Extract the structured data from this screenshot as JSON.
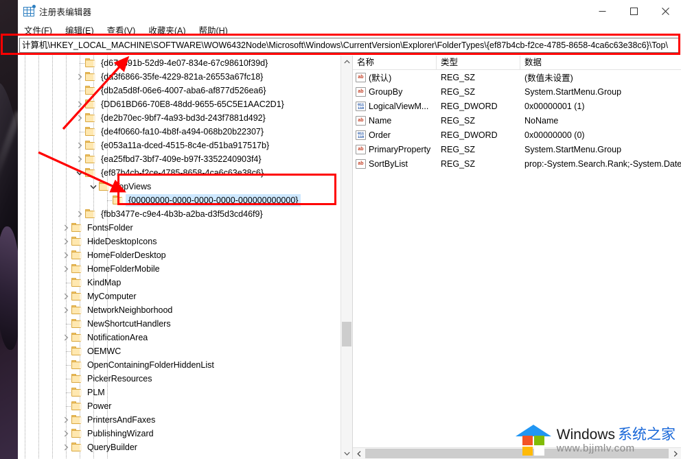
{
  "window": {
    "title": "注册表编辑器",
    "icon": "registry-editor-icon",
    "controls": {
      "minimize": "最小化",
      "maximize": "最大化",
      "close": "关闭"
    }
  },
  "menubar": {
    "items": [
      {
        "label": "文件(F)",
        "name": "menu-file"
      },
      {
        "label": "编辑(E)",
        "name": "menu-edit"
      },
      {
        "label": "查看(V)",
        "name": "menu-view"
      },
      {
        "label": "收藏夹(A)",
        "name": "menu-favorites"
      },
      {
        "label": "帮助(H)",
        "name": "menu-help"
      }
    ]
  },
  "address": {
    "value": "计算机\\HKEY_LOCAL_MACHINE\\SOFTWARE\\WOW6432Node\\Microsoft\\Windows\\CurrentVersion\\Explorer\\FolderTypes\\{ef87b4cb-f2ce-4785-8658-4ca6c63e38c6}\\Top\\",
    "placeholder": "计算机\\"
  },
  "tree": {
    "items": [
      {
        "label": "{d674391b-52d9-4e07-834e-67c98610f39d}",
        "depth": 4,
        "twist": "none",
        "selected": false
      },
      {
        "label": "{da3f6866-35fe-4229-821a-26553a67fc18}",
        "depth": 4,
        "twist": "collapsed",
        "selected": false
      },
      {
        "label": "{db2a5d8f-06e6-4007-aba6-af877d526ea6}",
        "depth": 4,
        "twist": "none",
        "selected": false
      },
      {
        "label": "{DD61BD66-70E8-48dd-9655-65C5E1AAC2D1}",
        "depth": 4,
        "twist": "collapsed",
        "selected": false
      },
      {
        "label": "{de2b70ec-9bf7-4a93-bd3d-243f7881d492}",
        "depth": 4,
        "twist": "collapsed",
        "selected": false
      },
      {
        "label": "{de4f0660-fa10-4b8f-a494-068b20b22307}",
        "depth": 4,
        "twist": "none",
        "selected": false
      },
      {
        "label": "{e053a11a-dced-4515-8c4e-d51ba917517b}",
        "depth": 4,
        "twist": "collapsed",
        "selected": false
      },
      {
        "label": "{ea25fbd7-3bf7-409e-b97f-3352240903f4}",
        "depth": 4,
        "twist": "collapsed",
        "selected": false
      },
      {
        "label": "{ef87b4cb-f2ce-4785-8658-4ca6c63e38c6}",
        "depth": 4,
        "twist": "expanded",
        "selected": false
      },
      {
        "label": "TopViews",
        "depth": 5,
        "twist": "expanded",
        "selected": false
      },
      {
        "label": "{00000000-0000-0000-0000-000000000000}",
        "depth": 6,
        "twist": "none",
        "selected": true
      },
      {
        "label": "{fbb3477e-c9e4-4b3b-a2ba-d3f5d3cd46f9}",
        "depth": 4,
        "twist": "collapsed",
        "selected": false
      },
      {
        "label": "FontsFolder",
        "depth": 3,
        "twist": "collapsed",
        "selected": false
      },
      {
        "label": "HideDesktopIcons",
        "depth": 3,
        "twist": "collapsed",
        "selected": false
      },
      {
        "label": "HomeFolderDesktop",
        "depth": 3,
        "twist": "collapsed",
        "selected": false
      },
      {
        "label": "HomeFolderMobile",
        "depth": 3,
        "twist": "collapsed",
        "selected": false
      },
      {
        "label": "KindMap",
        "depth": 3,
        "twist": "none",
        "selected": false
      },
      {
        "label": "MyComputer",
        "depth": 3,
        "twist": "collapsed",
        "selected": false
      },
      {
        "label": "NetworkNeighborhood",
        "depth": 3,
        "twist": "collapsed",
        "selected": false
      },
      {
        "label": "NewShortcutHandlers",
        "depth": 3,
        "twist": "none",
        "selected": false
      },
      {
        "label": "NotificationArea",
        "depth": 3,
        "twist": "collapsed",
        "selected": false
      },
      {
        "label": "OEMWC",
        "depth": 3,
        "twist": "none",
        "selected": false
      },
      {
        "label": "OpenContainingFolderHiddenList",
        "depth": 3,
        "twist": "none",
        "selected": false
      },
      {
        "label": "PickerResources",
        "depth": 3,
        "twist": "none",
        "selected": false
      },
      {
        "label": "PLM",
        "depth": 3,
        "twist": "none",
        "selected": false
      },
      {
        "label": "Power",
        "depth": 3,
        "twist": "none",
        "selected": false
      },
      {
        "label": "PrintersAndFaxes",
        "depth": 3,
        "twist": "collapsed",
        "selected": false
      },
      {
        "label": "PublishingWizard",
        "depth": 3,
        "twist": "collapsed",
        "selected": false
      },
      {
        "label": "QueryBuilder",
        "depth": 3,
        "twist": "collapsed",
        "selected": false
      }
    ]
  },
  "list": {
    "columns": [
      {
        "label": "名称",
        "name": "column-name"
      },
      {
        "label": "类型",
        "name": "column-type"
      },
      {
        "label": "数据",
        "name": "column-data"
      }
    ],
    "rows": [
      {
        "name": "(默认)",
        "icon": "string-value-icon",
        "type": "REG_SZ",
        "data": "(数值未设置)"
      },
      {
        "name": "GroupBy",
        "icon": "string-value-icon",
        "type": "REG_SZ",
        "data": "System.StartMenu.Group"
      },
      {
        "name": "LogicalViewM...",
        "icon": "dword-value-icon",
        "type": "REG_DWORD",
        "data": "0x00000001 (1)"
      },
      {
        "name": "Name",
        "icon": "string-value-icon",
        "type": "REG_SZ",
        "data": "NoName"
      },
      {
        "name": "Order",
        "icon": "dword-value-icon",
        "type": "REG_DWORD",
        "data": "0x00000000 (0)"
      },
      {
        "name": "PrimaryProperty",
        "icon": "string-value-icon",
        "type": "REG_SZ",
        "data": "System.StartMenu.Group"
      },
      {
        "name": "SortByList",
        "icon": "string-value-icon",
        "type": "REG_SZ",
        "data": "prop:-System.Search.Rank;-System.Date"
      }
    ]
  },
  "watermark": {
    "brand_en": "Windows",
    "brand_cn": "系统之家",
    "url": "www.bjjmlv.com"
  },
  "annotations": {
    "highlight_color": "#ff0000",
    "arrow_count": 2,
    "boxes": [
      "address-bar-highlight",
      "topviews-subkey-highlight"
    ]
  }
}
